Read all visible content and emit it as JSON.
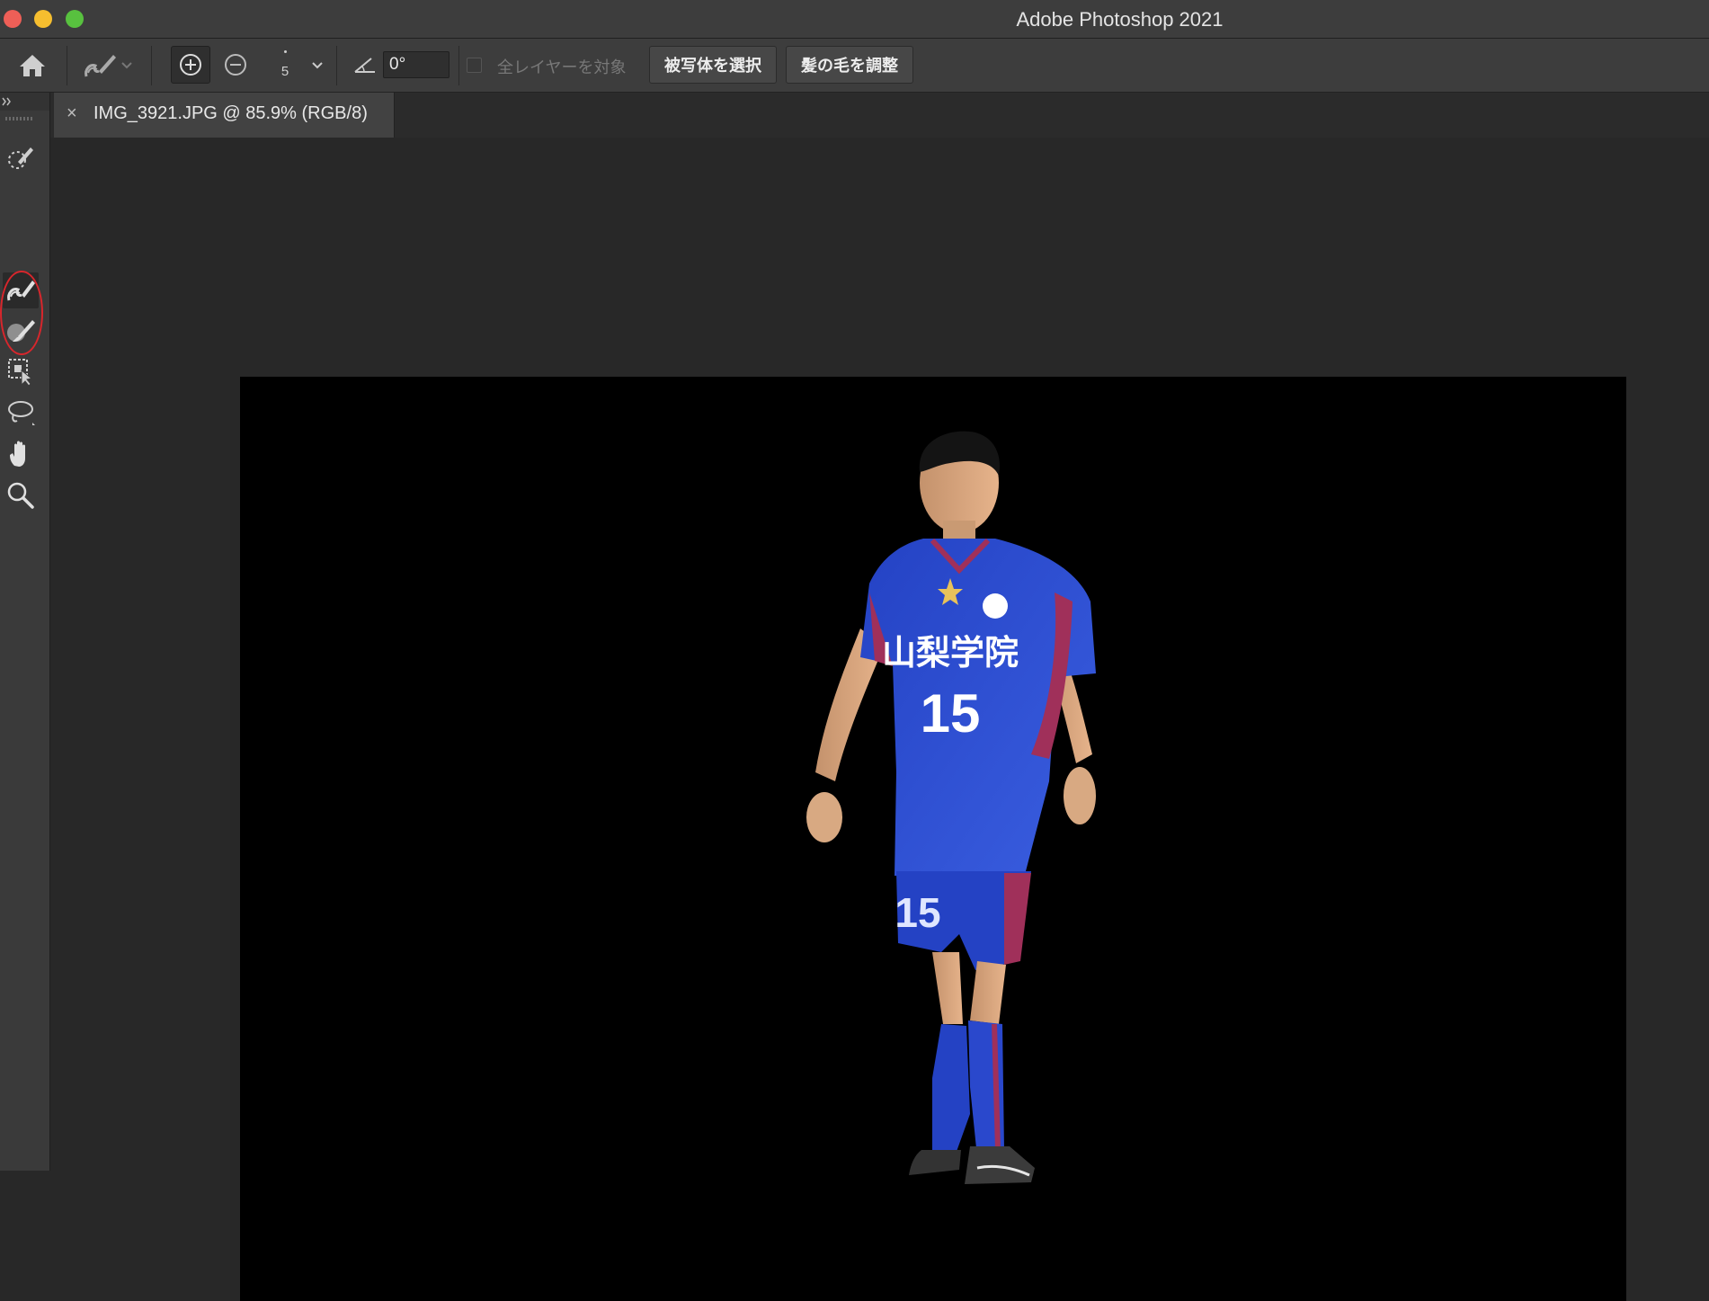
{
  "window": {
    "app_title": "Adobe Photoshop 2021"
  },
  "options_bar": {
    "brush_size": "5",
    "angle_value": "0°",
    "sample_all_layers_label": "全レイヤーを対象",
    "select_subject_label": "被写体を選択",
    "refine_hair_label": "髪の毛を調整"
  },
  "document": {
    "tab_close_glyph": "×",
    "tab_title": "IMG_3921.JPG @ 85.9% (RGB/8)",
    "canvas_background": "#000000"
  },
  "subject": {
    "jersey_text": "山梨学院",
    "jersey_number": "15",
    "shorts_number": "15",
    "jersey_color": "#2d4fd1",
    "accent_color": "#a0305a"
  },
  "tools": [
    {
      "name": "quick-selection-icon"
    },
    {
      "name": "refine-edge-brush-icon",
      "active": true
    },
    {
      "name": "brush-icon"
    },
    {
      "name": "object-selection-icon"
    },
    {
      "name": "lasso-icon"
    },
    {
      "name": "hand-icon"
    },
    {
      "name": "zoom-icon"
    }
  ],
  "colors": {
    "highlight_circle": "#d8262c"
  }
}
